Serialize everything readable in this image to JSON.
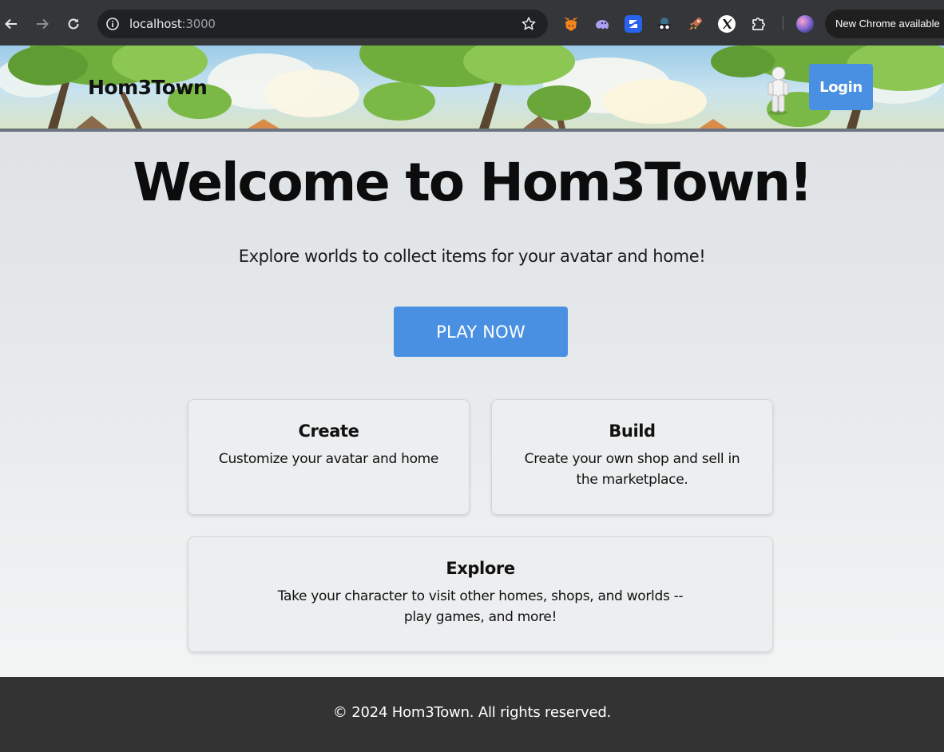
{
  "browser": {
    "url_host": "localhost",
    "url_port": ":3000",
    "update_notice": "New Chrome available",
    "extensions": [
      "metamask-fox-icon",
      "phantom-ghost-icon",
      "zerion-icon",
      "spy-glasses-icon",
      "rocket-icon",
      "x-icon",
      "puzzle-extensions-icon"
    ]
  },
  "header": {
    "logo": "Hom3Town",
    "login_label": "Login"
  },
  "hero": {
    "title": "Welcome to Hom3Town!",
    "subtitle": "Explore worlds to collect items for your avatar and home!",
    "cta_label": "PLAY NOW"
  },
  "features": [
    {
      "title": "Create",
      "description": "Customize your avatar and home"
    },
    {
      "title": "Build",
      "description": "Create your own shop and sell in the marketplace."
    },
    {
      "title": "Explore",
      "description": "Take your character to visit other homes, shops, and worlds -- play games, and more!"
    }
  ],
  "footer": {
    "copyright": "© 2024 Hom3Town. All rights reserved."
  },
  "colors": {
    "accent": "#4a90e2",
    "footer_bg": "#333333",
    "chrome_bg": "#35363a"
  }
}
